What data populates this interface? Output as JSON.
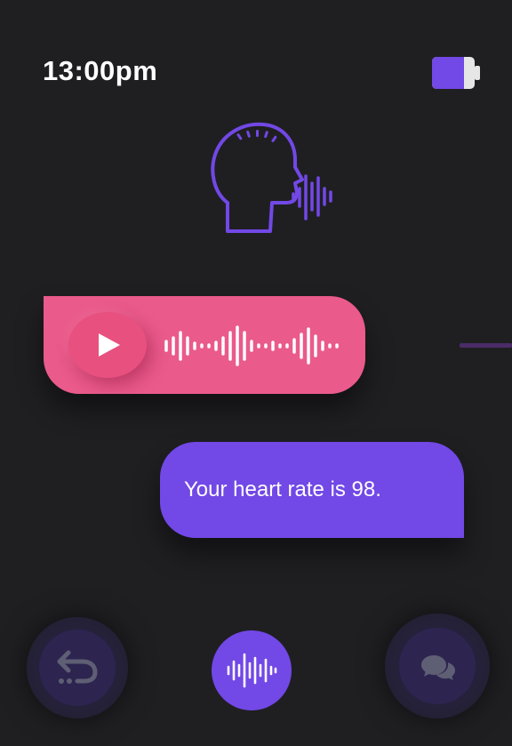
{
  "status_bar": {
    "time": "13:00pm",
    "battery_icon": "battery-icon",
    "battery_level": 0.7,
    "battery_color": "#7248e6"
  },
  "header": {
    "icon": "speaking-head-icon",
    "icon_color": "#7248e6"
  },
  "messages": [
    {
      "type": "voice",
      "icon": "play-icon",
      "waveform_icon": "audio-waveform-icon",
      "color": "#ea5a8b"
    },
    {
      "type": "text",
      "text": "Your heart rate is 98.",
      "color": "#7248e6"
    }
  ],
  "bottom_bar": {
    "back_icon": "undo-arrow-icon",
    "voice_icon": "voice-waveform-icon",
    "chat_icon": "chat-bubbles-icon",
    "accent": "#7248e6"
  }
}
